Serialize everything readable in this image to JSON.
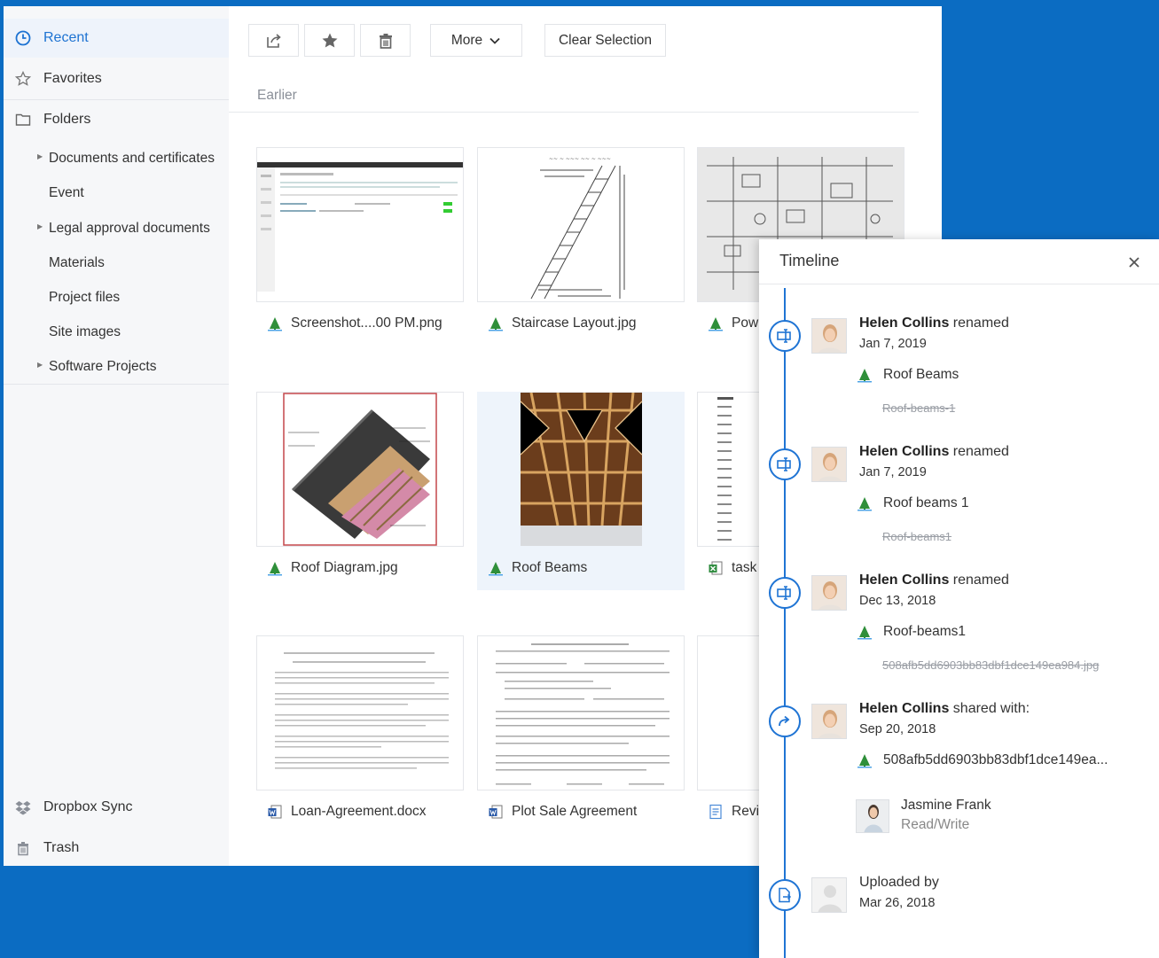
{
  "sidebar": {
    "nav": [
      {
        "label": "Recent",
        "icon": "clock-icon",
        "active": true
      },
      {
        "label": "Favorites",
        "icon": "star-icon"
      },
      {
        "label": "Folders",
        "icon": "folder-icon"
      }
    ],
    "folders": [
      {
        "label": "Documents and certificates",
        "expandable": true
      },
      {
        "label": "Event",
        "expandable": false
      },
      {
        "label": "Legal approval documents",
        "expandable": true
      },
      {
        "label": "Materials",
        "expandable": false
      },
      {
        "label": "Project files",
        "expandable": false
      },
      {
        "label": "Site images",
        "expandable": false
      },
      {
        "label": "Software Projects",
        "expandable": true
      }
    ],
    "bottom": [
      {
        "label": "Dropbox Sync",
        "icon": "dropbox-icon"
      },
      {
        "label": "Trash",
        "icon": "trash-icon"
      }
    ]
  },
  "toolbar": {
    "share_icon": "share-icon",
    "favorite_icon": "star-icon",
    "delete_icon": "trash-icon",
    "more_label": "More",
    "clear_label": "Clear Selection"
  },
  "section": {
    "label": "Earlier"
  },
  "files": [
    {
      "name": "Screenshot....00 PM.png",
      "type": "image"
    },
    {
      "name": "Staircase Layout.jpg",
      "type": "image"
    },
    {
      "name": "Pow",
      "type": "image"
    },
    {
      "name": "Roof Diagram.jpg",
      "type": "image"
    },
    {
      "name": "Roof Beams",
      "type": "image",
      "selected": true
    },
    {
      "name": "task",
      "type": "spreadsheet"
    },
    {
      "name": "Loan-Agreement.docx",
      "type": "document"
    },
    {
      "name": "Plot Sale Agreement",
      "type": "document"
    },
    {
      "name": "Revi",
      "type": "text"
    }
  ],
  "timeline": {
    "title": "Timeline",
    "events": [
      {
        "user": "Helen Collins",
        "action": " renamed",
        "date": "Jan 7, 2019",
        "file": "Roof Beams",
        "old_name": "Roof-beams-1"
      },
      {
        "user": "Helen Collins",
        "action": " renamed",
        "date": "Jan 7, 2019",
        "file": "Roof beams 1",
        "old_name": "Roof-beams1"
      },
      {
        "user": "Helen Collins",
        "action": " renamed",
        "date": "Dec 13, 2018",
        "file": "Roof-beams1",
        "old_name": "508afb5dd6903bb83dbf1dce149ea984.jpg"
      },
      {
        "user": "Helen Collins",
        "action": " shared with:",
        "date": "Sep 20, 2018",
        "file": "508afb5dd6903bb83dbf1dce149ea...",
        "shared_user": "Jasmine Frank",
        "permission": "Read/Write"
      },
      {
        "user": "",
        "action": "Uploaded by",
        "date": "Mar 26, 2018"
      }
    ]
  },
  "colors": {
    "accent": "#1e73d2",
    "background": "#0b6cc2",
    "image_icon_green": "#2f8f3a"
  }
}
